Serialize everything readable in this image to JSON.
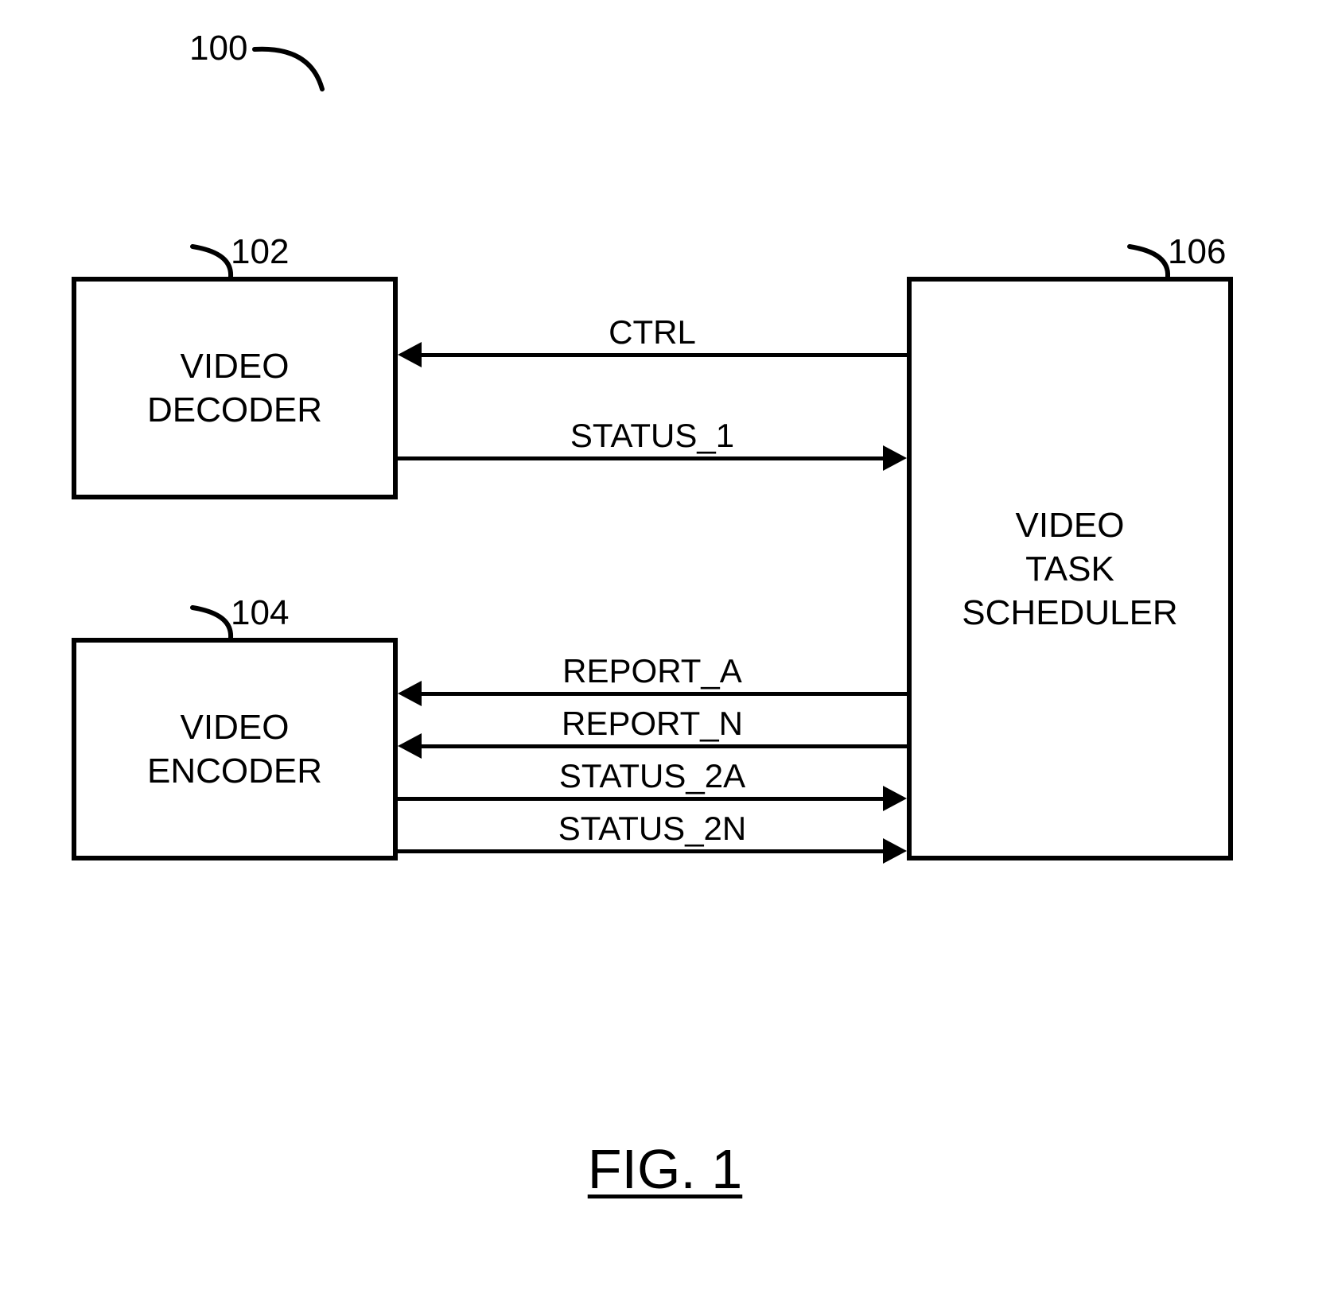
{
  "refs": {
    "overall": "100",
    "decoder": "102",
    "encoder": "104",
    "scheduler": "106"
  },
  "blocks": {
    "decoder": "VIDEO\nDECODER",
    "encoder": "VIDEO\nENCODER",
    "scheduler": "VIDEO\nTASK\nSCHEDULER"
  },
  "signals": {
    "ctrl": "CTRL",
    "status1": "STATUS_1",
    "report_a": "REPORT_A",
    "report_n": "REPORT_N",
    "status_2a": "STATUS_2A",
    "status_2n": "STATUS_2N"
  },
  "caption": "FIG. 1",
  "chart_data": {
    "type": "block-diagram",
    "title": "FIG. 1",
    "system_ref": "100",
    "nodes": [
      {
        "id": "102",
        "label": "VIDEO DECODER"
      },
      {
        "id": "104",
        "label": "VIDEO ENCODER"
      },
      {
        "id": "106",
        "label": "VIDEO TASK SCHEDULER"
      }
    ],
    "edges": [
      {
        "from": "106",
        "to": "102",
        "label": "CTRL"
      },
      {
        "from": "102",
        "to": "106",
        "label": "STATUS_1"
      },
      {
        "from": "106",
        "to": "104",
        "label": "REPORT_A"
      },
      {
        "from": "106",
        "to": "104",
        "label": "REPORT_N"
      },
      {
        "from": "104",
        "to": "106",
        "label": "STATUS_2A"
      },
      {
        "from": "104",
        "to": "106",
        "label": "STATUS_2N"
      }
    ]
  }
}
